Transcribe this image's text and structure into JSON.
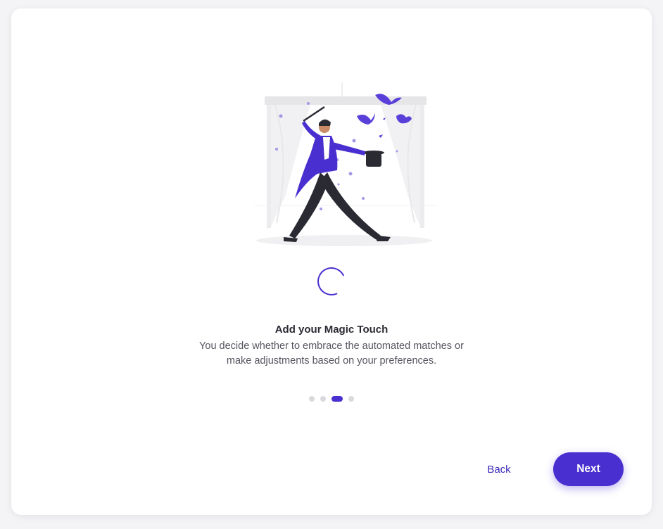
{
  "onboarding": {
    "title": "Add your Magic Touch",
    "description": "You decide whether to embrace the automated matches or make adjustments based on your preferences.",
    "steps_total": 4,
    "current_step": 3,
    "illustration": "magician-with-top-hat-and-doves-illustration",
    "loading": true
  },
  "actions": {
    "back_label": "Back",
    "next_label": "Next"
  },
  "colors": {
    "accent": "#4a2fd0",
    "text_primary": "#2a2a33",
    "text_secondary": "#55555f",
    "dot_inactive": "#d9d9de",
    "background": "#f4f4f6"
  }
}
